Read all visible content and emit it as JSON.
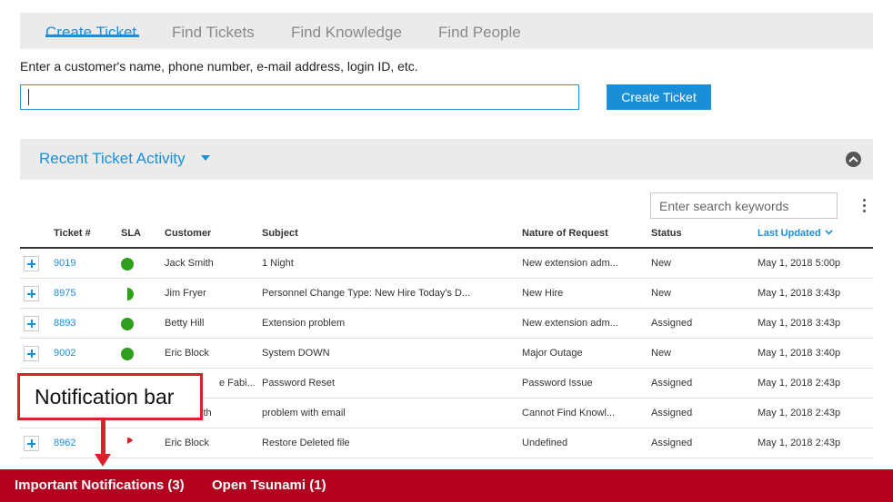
{
  "tabs": [
    {
      "label": "Create Ticket",
      "active": true
    },
    {
      "label": "Find Tickets"
    },
    {
      "label": "Find Knowledge"
    },
    {
      "label": "Find People"
    }
  ],
  "create": {
    "hint": "Enter a customer's name, phone number, e-mail address, login ID, etc.",
    "input_value": "",
    "button_label": "Create Ticket"
  },
  "activity": {
    "title": "Recent Ticket Activity",
    "search_placeholder": "Enter search keywords"
  },
  "table": {
    "columns": [
      "Ticket #",
      "SLA",
      "Customer",
      "Subject",
      "Nature of Request",
      "Status",
      "Last Updated"
    ],
    "sorted_column": "Last Updated",
    "rows": [
      {
        "ticket": "9019",
        "sla": "full",
        "customer": "Jack Smith",
        "subject": "1 Night",
        "nature": "New extension adm...",
        "status": "New",
        "updated": "May 1, 2018 5:00p"
      },
      {
        "ticket": "8975",
        "sla": "half",
        "customer": "Jim Fryer",
        "subject": "Personnel Change Type: New Hire Today's D...",
        "nature": "New Hire",
        "status": "New",
        "updated": "May 1, 2018 3:43p"
      },
      {
        "ticket": "8893",
        "sla": "full",
        "customer": "Betty Hill",
        "subject": "Extension problem",
        "nature": "New extension adm...",
        "status": "Assigned",
        "updated": "May 1, 2018 3:43p"
      },
      {
        "ticket": "9002",
        "sla": "full",
        "customer": "Eric Block",
        "subject": "System DOWN",
        "nature": "Major Outage",
        "status": "New",
        "updated": "May 1, 2018 3:40p"
      },
      {
        "ticket": "",
        "sla": "",
        "customer": "e Fabi...",
        "subject": "Password Reset",
        "nature": "Password Issue",
        "status": "Assigned",
        "updated": "May 1, 2018 2:43p"
      },
      {
        "ticket": "",
        "sla": "",
        "customer": "ith",
        "subject": "problem with email",
        "nature": "Cannot Find Knowl...",
        "status": "Assigned",
        "updated": "May 1, 2018 2:43p"
      },
      {
        "ticket": "8962",
        "sla": "sliver",
        "customer": "Eric Block",
        "subject": "Restore Deleted file",
        "nature": "Undefined",
        "status": "Assigned",
        "updated": "May 1, 2018 2:43p"
      }
    ]
  },
  "callout": {
    "text": "Notification bar"
  },
  "notifications": [
    {
      "label": "Important Notifications (3)"
    },
    {
      "label": "Open Tsunami (1)"
    }
  ],
  "colors": {
    "accent": "#1a8fd8",
    "sla_green": "#2e9e1c",
    "sla_red": "#d3222a",
    "notification_bar": "#b3001e",
    "callout": "#d9222a"
  }
}
